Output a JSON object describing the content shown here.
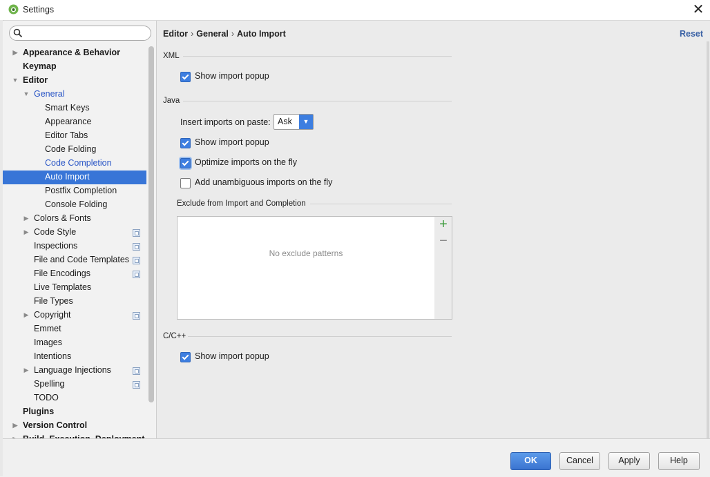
{
  "window": {
    "title": "Settings",
    "close_glyph": "✕"
  },
  "search": {
    "value": "",
    "placeholder": ""
  },
  "tree": [
    {
      "label": "Appearance & Behavior",
      "level": 0,
      "arrow": "right",
      "bold": true
    },
    {
      "label": "Keymap",
      "level": 0,
      "arrow": "none",
      "bold": true
    },
    {
      "label": "Editor",
      "level": 0,
      "arrow": "down",
      "bold": true
    },
    {
      "label": "General",
      "level": 1,
      "arrow": "down",
      "link": true
    },
    {
      "label": "Smart Keys",
      "level": 2,
      "arrow": "none"
    },
    {
      "label": "Appearance",
      "level": 2,
      "arrow": "none"
    },
    {
      "label": "Editor Tabs",
      "level": 2,
      "arrow": "none"
    },
    {
      "label": "Code Folding",
      "level": 2,
      "arrow": "none"
    },
    {
      "label": "Code Completion",
      "level": 2,
      "arrow": "none",
      "link": true
    },
    {
      "label": "Auto Import",
      "level": 2,
      "arrow": "none",
      "selected": true
    },
    {
      "label": "Postfix Completion",
      "level": 2,
      "arrow": "none"
    },
    {
      "label": "Console Folding",
      "level": 2,
      "arrow": "none"
    },
    {
      "label": "Colors & Fonts",
      "level": 1,
      "arrow": "right"
    },
    {
      "label": "Code Style",
      "level": 1,
      "arrow": "right",
      "copy": true
    },
    {
      "label": "Inspections",
      "level": 1,
      "arrow": "none",
      "copy": true
    },
    {
      "label": "File and Code Templates",
      "level": 1,
      "arrow": "none",
      "copy": true
    },
    {
      "label": "File Encodings",
      "level": 1,
      "arrow": "none",
      "copy": true
    },
    {
      "label": "Live Templates",
      "level": 1,
      "arrow": "none"
    },
    {
      "label": "File Types",
      "level": 1,
      "arrow": "none"
    },
    {
      "label": "Copyright",
      "level": 1,
      "arrow": "right",
      "copy": true
    },
    {
      "label": "Emmet",
      "level": 1,
      "arrow": "none"
    },
    {
      "label": "Images",
      "level": 1,
      "arrow": "none"
    },
    {
      "label": "Intentions",
      "level": 1,
      "arrow": "none"
    },
    {
      "label": "Language Injections",
      "level": 1,
      "arrow": "right",
      "copy": true
    },
    {
      "label": "Spelling",
      "level": 1,
      "arrow": "none",
      "copy": true
    },
    {
      "label": "TODO",
      "level": 1,
      "arrow": "none"
    },
    {
      "label": "Plugins",
      "level": 0,
      "arrow": "none",
      "bold": true
    },
    {
      "label": "Version Control",
      "level": 0,
      "arrow": "right",
      "bold": true
    },
    {
      "label": "Build, Execution, Deployment",
      "level": 0,
      "arrow": "right",
      "bold": true
    }
  ],
  "breadcrumb": {
    "items": [
      "Editor",
      "General",
      "Auto Import"
    ],
    "sep": "›"
  },
  "reset_label": "Reset",
  "xml": {
    "title": "XML",
    "show_import_popup": {
      "label": "Show import popup",
      "checked": true
    }
  },
  "java": {
    "title": "Java",
    "paste_label": "Insert imports on paste:",
    "paste_value": "Ask",
    "show_import_popup": {
      "label": "Show import popup",
      "checked": true
    },
    "optimize_imports": {
      "label": "Optimize imports on the fly",
      "checked": true
    },
    "add_unambiguous": {
      "label": "Add unambiguous imports on the fly",
      "checked": false
    }
  },
  "exclude": {
    "title": "Exclude from Import and Completion",
    "empty_text": "No exclude patterns",
    "add_glyph": "+",
    "remove_glyph": "−"
  },
  "cpp": {
    "title": "C/C++",
    "show_import_popup": {
      "label": "Show import popup",
      "checked": true
    }
  },
  "buttons": {
    "ok": "OK",
    "cancel": "Cancel",
    "apply": "Apply",
    "help": "Help"
  },
  "colors": {
    "selection": "#3875d7",
    "link": "#2a56c6",
    "accent": "#3d7ee0"
  }
}
